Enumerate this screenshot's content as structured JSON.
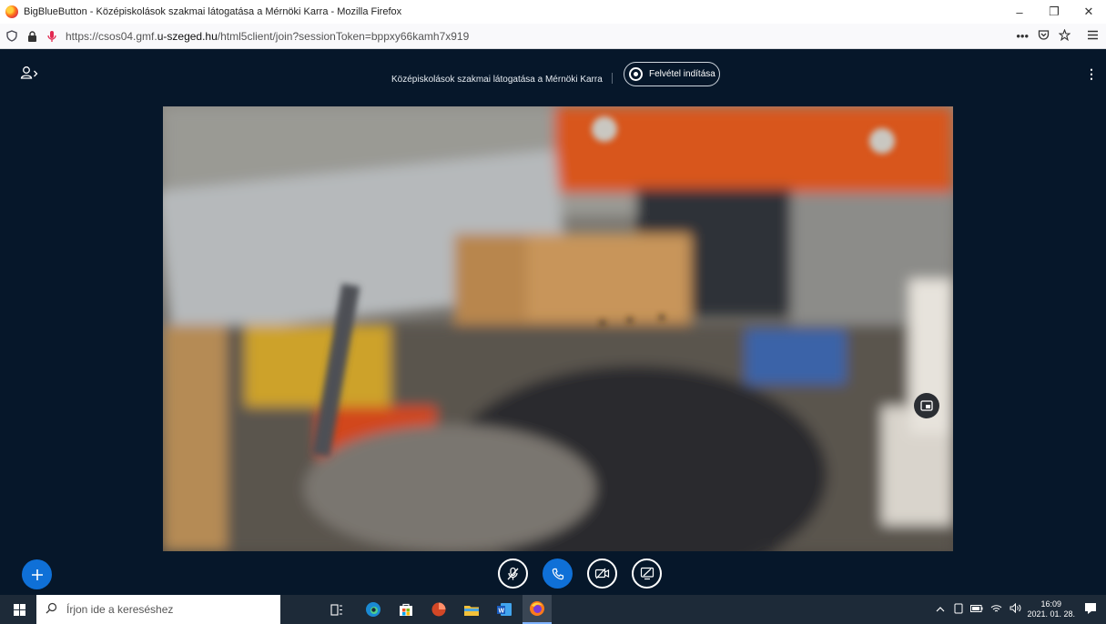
{
  "browser": {
    "window_title": "BigBlueButton - Középiskolások szakmai látogatása a Mérnöki Karra - Mozilla Firefox",
    "url_prefix": "https://csos04.gmf.",
    "url_domain": "u-szeged.hu",
    "url_suffix": "/html5client/join?sessionToken=bppxy66kamh7x919",
    "more_label": "•••",
    "minimize_label": "–",
    "restore_label": "❐",
    "close_label": "✕"
  },
  "meeting": {
    "title": "Középiskolások szakmai látogatása a Mérnöki Karra",
    "record_label": "Felvétel indítása",
    "options_label": "⋮"
  },
  "taskbar": {
    "search_placeholder": "Írjon ide a kereséshez",
    "time": "16:09",
    "date": "2021. 01. 28."
  },
  "colors": {
    "background": "#06172a",
    "accent": "#0f70d7",
    "taskbar": "#1d2a38"
  },
  "icons": [
    "firefox-icon",
    "shield-icon",
    "lock-icon",
    "microphone-icon",
    "users-icon",
    "record-icon",
    "kebab-icon",
    "pip-icon",
    "plus-icon",
    "mic-muted-icon",
    "phone-icon",
    "camera-off-icon",
    "screen-share-off-icon",
    "windows-start-icon",
    "search-icon"
  ]
}
